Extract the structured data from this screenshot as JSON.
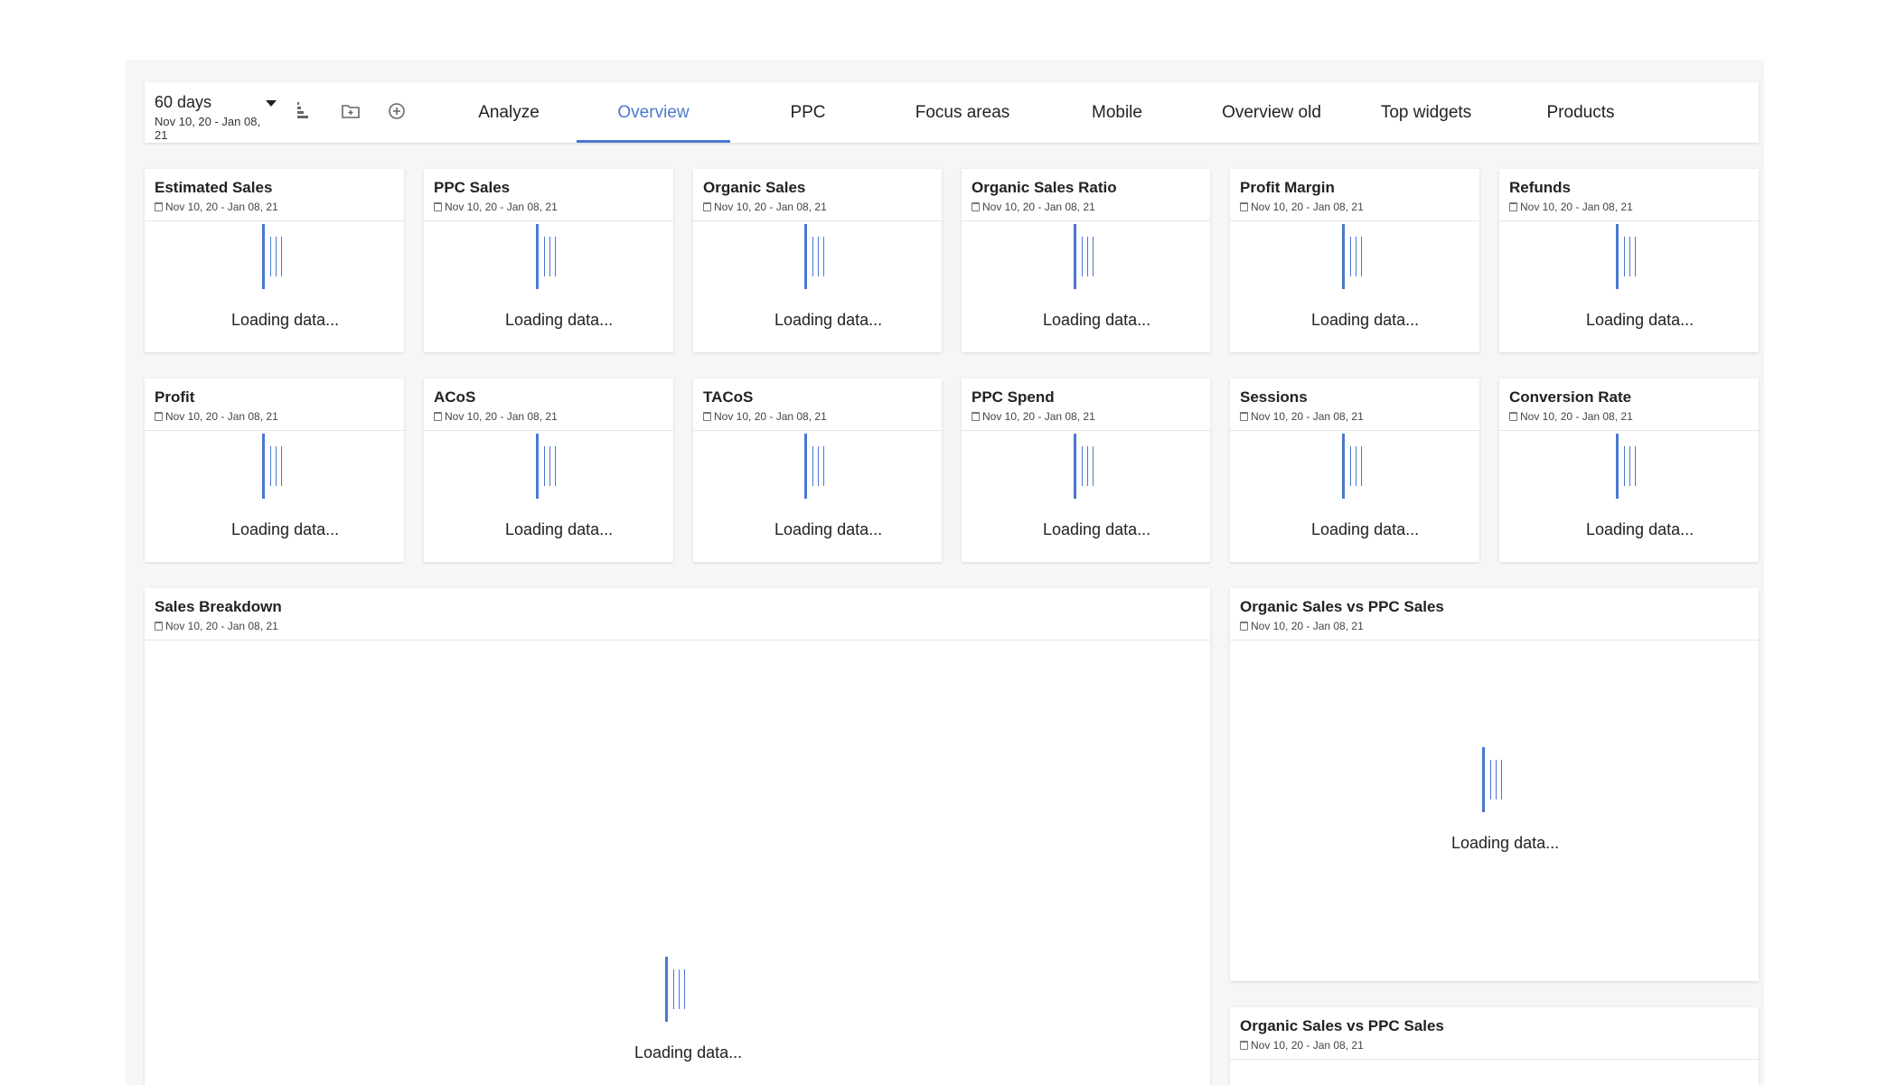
{
  "toolbar": {
    "period_label": "60 days",
    "period_range": "Nov 10, 20 - Jan 08, 21",
    "tabs": [
      "Analyze",
      "Overview",
      "PPC",
      "Focus areas",
      "Mobile",
      "Overview old",
      "Top widgets",
      "Products"
    ],
    "active_tab": "Overview"
  },
  "accent_color": "#4a78d0",
  "loading_text": "Loading data...",
  "date_range": "Nov 10, 20 - Jan 08, 21",
  "widgets": [
    {
      "title": "Estimated Sales"
    },
    {
      "title": "PPC Sales"
    },
    {
      "title": "Organic Sales"
    },
    {
      "title": "Organic Sales Ratio"
    },
    {
      "title": "Profit Margin"
    },
    {
      "title": "Refunds"
    },
    {
      "title": "Profit"
    },
    {
      "title": "ACoS"
    },
    {
      "title": "TACoS"
    },
    {
      "title": "PPC Spend"
    },
    {
      "title": "Sessions"
    },
    {
      "title": "Conversion Rate"
    },
    {
      "title": "Sales Breakdown"
    },
    {
      "title": "Organic Sales vs PPC Sales"
    },
    {
      "title": "Organic Sales vs PPC Sales"
    }
  ]
}
